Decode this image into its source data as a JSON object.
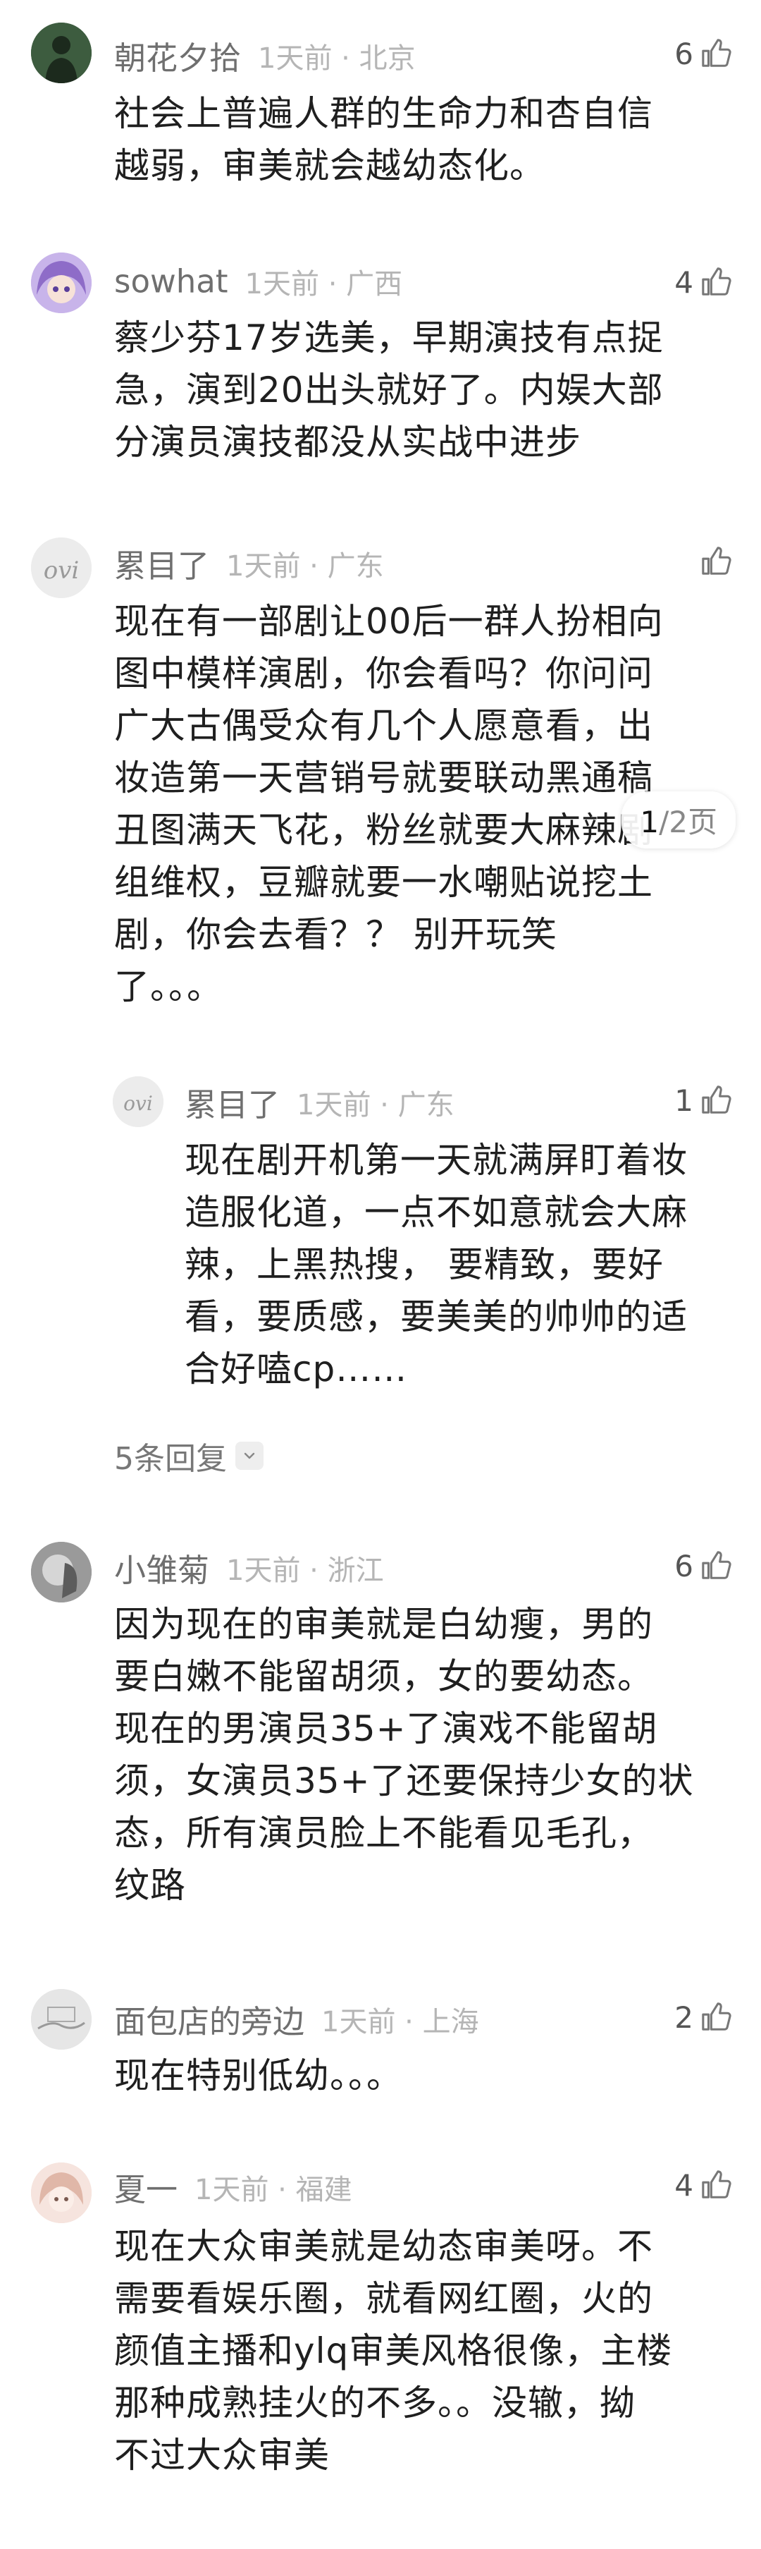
{
  "comments": [
    {
      "user": "朝花夕拾",
      "time": "1天前",
      "location": "北京",
      "likes": "6",
      "text": "社会上普遍人群的生命力和杏自信\n越弱，审美就会越幼态化。",
      "avatar_icon": "person-avatar-icon",
      "avatar_color": "#2b4a2e"
    },
    {
      "user": "sowhat",
      "time": "1天前",
      "location": "广西",
      "likes": "4",
      "text": "蔡少芬17岁选美，早期演技有点捉\n急，演到20出头就好了。内娱大部\n分演员演技都没从实战中进步",
      "avatar_icon": "anime-avatar-icon",
      "avatar_color": "#b89ad8"
    },
    {
      "user": "累目了",
      "time": "1天前",
      "location": "广东",
      "likes": "",
      "text": "现在有一部剧让00后一群人扮相向\n图中模样演剧，你会看吗？你问问\n广大古偶受众有几个人愿意看，出\n妆造第一天营销号就要联动黑通稿\n丑图满天飞花，粉丝就要大麻辣剧\n组维权，豆瓣就要一水嘲贴说挖土\n剧，你会去看？？ 别开玩笑\n了。。。",
      "avatar_icon": "ovi-avatar-icon",
      "avatar_color": "#e8e8e8"
    },
    {
      "user": "小雏菊",
      "time": "1天前",
      "location": "浙江",
      "likes": "6",
      "text": "因为现在的审美就是白幼瘦，男的\n要白嫩不能留胡须，女的要幼态。\n现在的男演员35+了演戏不能留胡\n须，女演员35+了还要保持少女的状\n态，所有演员脸上不能看见毛孔，\n纹路",
      "avatar_icon": "photo-avatar-icon",
      "avatar_color": "#8a8a8a"
    },
    {
      "user": "面包店的旁边",
      "time": "1天前",
      "location": "上海",
      "likes": "2",
      "text": "现在特别低幼。。。",
      "avatar_icon": "sketch-avatar-icon",
      "avatar_color": "#d8d8d8"
    },
    {
      "user": "夏一",
      "time": "1天前",
      "location": "福建",
      "likes": "4",
      "text": "现在大众审美就是幼态审美呀。不\n需要看娱乐圈，就看网红圈，火的\n颜值主播和ylq审美风格很像，主楼\n那种成熟挂火的不多。。没辙，拗\n不过大众审美",
      "avatar_icon": "doll-avatar-icon",
      "avatar_color": "#f1d6cf"
    }
  ],
  "reply": {
    "user": "累目了",
    "time": "1天前",
    "location": "广东",
    "likes": "1",
    "text": "现在剧开机第一天就满屏盯着妆\n造服化道，一点不如意就会大麻\n辣，上黑热搜， 要精致，要好\n看，要质感，要美美的帅帅的适\n合好嗑cp……"
  },
  "replies_link": "5条回复",
  "page_indicator": {
    "current": "1",
    "total": "/2页"
  },
  "colors": {
    "username": "#6f6f6f",
    "meta": "#b5b5b5",
    "text": "#1f1f1f"
  }
}
